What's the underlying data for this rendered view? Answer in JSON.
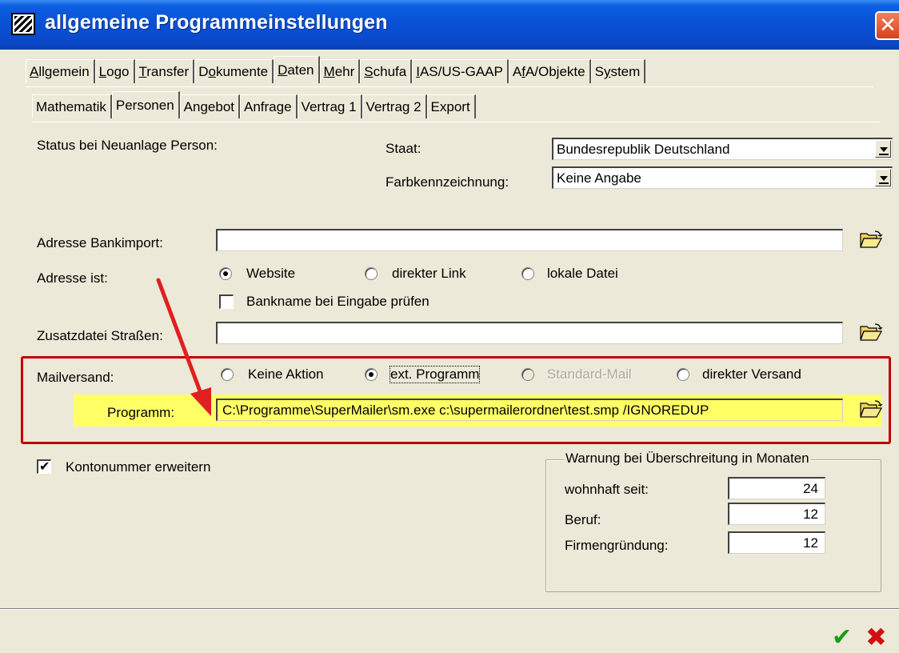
{
  "window": {
    "title": "allgemeine Programmeinstellungen",
    "close_glyph": "✕"
  },
  "main_tabs": [
    {
      "pre": "",
      "ul": "A",
      "post": "llgemein"
    },
    {
      "pre": "",
      "ul": "L",
      "post": "ogo"
    },
    {
      "pre": "",
      "ul": "T",
      "post": "ransfer"
    },
    {
      "pre": "D",
      "ul": "o",
      "post": "kumente"
    },
    {
      "pre": "",
      "ul": "D",
      "post": "aten"
    },
    {
      "pre": "",
      "ul": "M",
      "post": "ehr"
    },
    {
      "pre": "",
      "ul": "S",
      "post": "chufa"
    },
    {
      "pre": "",
      "ul": "I",
      "post": "AS/US-GAAP"
    },
    {
      "pre": "A",
      "ul": "f",
      "post": "A/Objekte"
    },
    {
      "pre": "S",
      "ul": "y",
      "post": "stem"
    }
  ],
  "sub_tabs": [
    "Mathematik",
    "Personen",
    "Angebot",
    "Anfrage",
    "Vertrag 1",
    "Vertrag 2",
    "Export"
  ],
  "form": {
    "status_label": "Status bei Neuanlage Person:",
    "staat_label": "Staat:",
    "staat_value": "Bundesrepublik Deutschland",
    "farb_label": "Farbkennzeichnung:",
    "farb_value": "Keine Angabe",
    "bankimport_label": "Adresse Bankimport:",
    "bankimport_value": "",
    "adresse_ist_label": "Adresse ist:",
    "radio_website": "Website",
    "radio_direkter_link": "direkter Link",
    "radio_lokale_datei": "lokale Datei",
    "bankname_check": "Bankname bei Eingabe prüfen",
    "zusatz_label": "Zusatzdatei Straßen:",
    "zusatz_value": "",
    "mailversand_label": "Mailversand:",
    "radio_keine_aktion": "Keine Aktion",
    "radio_ext_programm": "ext. Programm",
    "radio_standard_mail": "Standard-Mail",
    "radio_direkter_versand": "direkter Versand",
    "programm_label": "Programm:",
    "programm_value": "C:\\Programme\\SuperMailer\\sm.exe c:\\supermailerordner\\test.smp /IGNOREDUP",
    "kontonummer_check": "Kontonummer erweitern"
  },
  "warnung": {
    "legend": "Warnung bei Überschreitung in Monaten",
    "wohnhaft_label": "wohnhaft seit:",
    "wohnhaft_value": "24",
    "beruf_label": "Beruf:",
    "beruf_value": "12",
    "firmen_label": "Firmengründung:",
    "firmen_value": "12"
  },
  "footer": {
    "ok_glyph": "✔",
    "cancel_glyph": "✖"
  },
  "colors": {
    "highlight_border": "#c00000",
    "highlight_fill": "#ffff66",
    "annotation_arrow": "#e02020"
  }
}
